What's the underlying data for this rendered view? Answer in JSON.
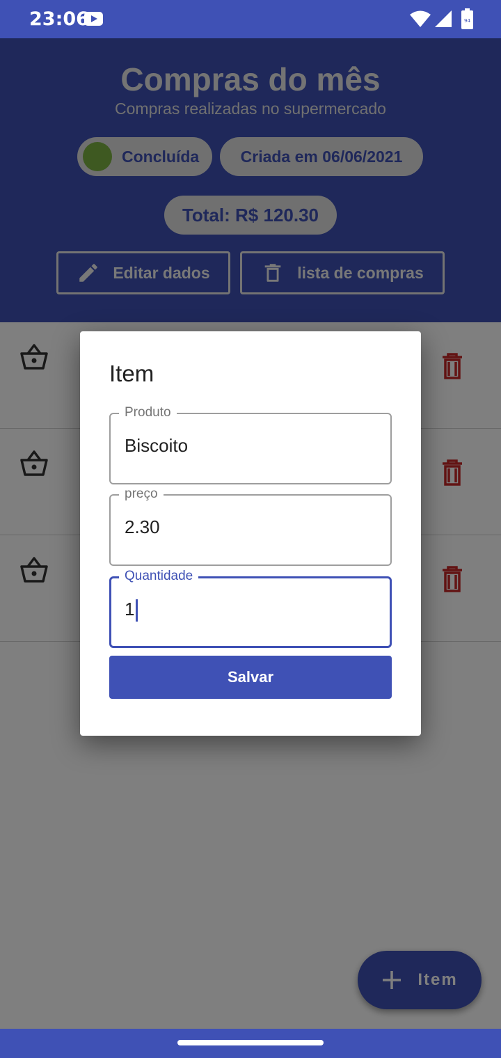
{
  "status_bar": {
    "time": "23:06",
    "battery_level": "94"
  },
  "header": {
    "title": "Compras do mês",
    "subtitle": "Compras realizadas no supermercado",
    "status_chip": "Concluída",
    "created_chip": "Criada em 06/06/2021",
    "total_chip": "Total: R$ 120.30",
    "edit_button": "Editar dados",
    "delete_list_button": "lista de compras"
  },
  "dialog": {
    "title": "Item",
    "fields": {
      "produto": {
        "label": "Produto",
        "value": "Biscoito"
      },
      "preco": {
        "label": "preço",
        "value": "2.30"
      },
      "quantidade": {
        "label": "Quantidade",
        "value": "1"
      }
    },
    "save_button": "Salvar"
  },
  "fab": {
    "label": "Item"
  },
  "colors": {
    "primary": "#3f51b5",
    "status_done": "#7cb342",
    "delete": "#c62828"
  }
}
